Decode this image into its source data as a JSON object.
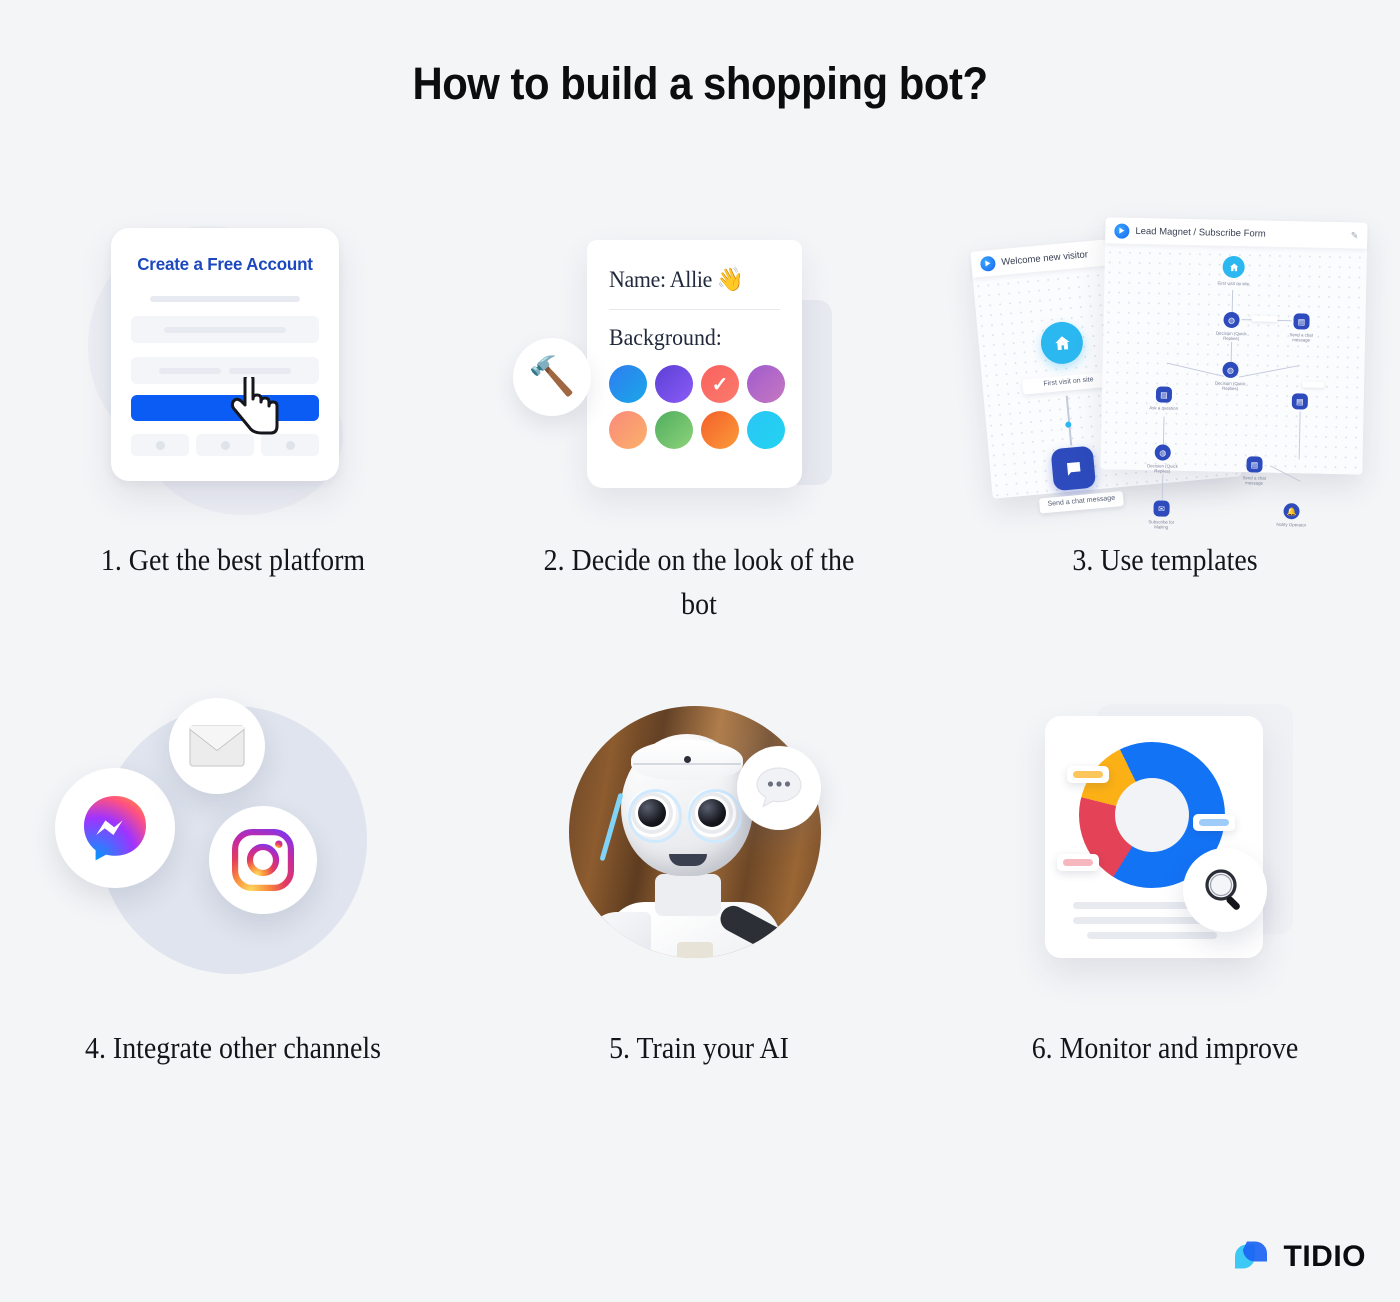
{
  "page": {
    "title": "How to build a shopping bot?",
    "background_color": "#f4f5f7"
  },
  "brand": {
    "name": "TIDIO",
    "color_light": "#31c6f5",
    "color_dark": "#1c64f2"
  },
  "steps": [
    {
      "number": "1.",
      "label": "1. Get the best platform",
      "art": "signup-form"
    },
    {
      "number": "2.",
      "label": "2. Decide on the look of the bot",
      "art": "bot-appearance"
    },
    {
      "number": "3.",
      "label": "3. Use templates",
      "art": "flow-templates"
    },
    {
      "number": "4.",
      "label": "4. Integrate other channels",
      "art": "channels"
    },
    {
      "number": "5.",
      "label": "5. Train your AI",
      "art": "robot-photo"
    },
    {
      "number": "6.",
      "label": "6. Monitor and improve",
      "art": "analytics-report"
    }
  ],
  "card_signup": {
    "heading": "Create a Free Account",
    "button_color": "#0a5cf5",
    "heading_color": "#1c47bf",
    "cursor_icon": "pointer-hand-icon"
  },
  "card_appearance": {
    "name_label": "Name: Allie",
    "name_emoji": "👋",
    "background_label": "Background:",
    "tool_emoji": "🔨",
    "selected_swatch_index": 2,
    "swatches": [
      {
        "name": "blue",
        "from": "#2f7df0",
        "to": "#1aa7e8"
      },
      {
        "name": "purple",
        "from": "#5b3fd6",
        "to": "#8b5cf6"
      },
      {
        "name": "coral",
        "from": "#f9615f",
        "to": "#fb7b6c",
        "selected": true
      },
      {
        "name": "magenta",
        "from": "#a05bcf",
        "to": "#c678c0"
      },
      {
        "name": "peach",
        "from": "#fa8a7a",
        "to": "#fbb06a"
      },
      {
        "name": "green",
        "from": "#4fae5e",
        "to": "#8ed27a"
      },
      {
        "name": "orange",
        "from": "#f45f2a",
        "to": "#fb9b3a"
      },
      {
        "name": "cyan",
        "from": "#29c6f5",
        "to": "#22d3f0"
      }
    ]
  },
  "card_templates": {
    "back_template_title": "Welcome new visitor",
    "front_template_title": "Lead Magnet / Subscribe Form",
    "edit_icon": "pencil-icon",
    "back_nodes": [
      {
        "label": "First visit on site",
        "icon": "home-icon",
        "color": "#2bb7f0"
      },
      {
        "label": "Send a chat message",
        "icon": "chat-icon",
        "color": "#2d4bbd"
      }
    ],
    "front_nodes": [
      {
        "label": "First visit on site",
        "icon": "home-icon"
      },
      {
        "label": "Decision (Quick Replies)",
        "icon": "decision-icon"
      },
      {
        "label": "Send a chat message",
        "icon": "chat-icon"
      },
      {
        "label": "Decision (Quick Replies)",
        "icon": "decision-icon"
      },
      {
        "label": "Ask a question",
        "icon": "form-icon"
      },
      {
        "label": "Decision (Quick Replies)",
        "icon": "decision-icon"
      },
      {
        "label": "Subscribe for Mailing",
        "icon": "mail-icon"
      },
      {
        "label": "Send a chat message",
        "icon": "chat-icon"
      },
      {
        "label": "Notify Operator",
        "icon": "bell-icon"
      }
    ]
  },
  "card_channels": {
    "circle_color": "#dfe4ee",
    "icons": [
      {
        "name": "messenger-icon",
        "label": "Messenger"
      },
      {
        "name": "email-icon",
        "label": "Email"
      },
      {
        "name": "instagram-icon",
        "label": "Instagram"
      }
    ]
  },
  "card_robot": {
    "photo_alt": "White humanoid Pepper robot in front of a wooden wall",
    "badge_icon": "chat-bubble-icon",
    "badge_dots": "•••"
  },
  "card_analytics": {
    "magnifier_icon": "magnifying-glass-icon",
    "chart_data": {
      "type": "pie",
      "title": "",
      "categories": [
        "Blue",
        "Yellow",
        "Red",
        "Blue (lower)"
      ],
      "values": [
        38,
        14,
        20,
        28
      ],
      "colors": [
        "#1373f5",
        "#fbb016",
        "#e34257",
        "#1373f5"
      ],
      "donut": true,
      "legend": "none",
      "callouts": [
        {
          "position": "upper-left",
          "color": "#fbb016"
        },
        {
          "position": "right",
          "color": "#9ecbf8"
        },
        {
          "position": "lower-left",
          "color": "#f6b7bf"
        }
      ]
    }
  }
}
